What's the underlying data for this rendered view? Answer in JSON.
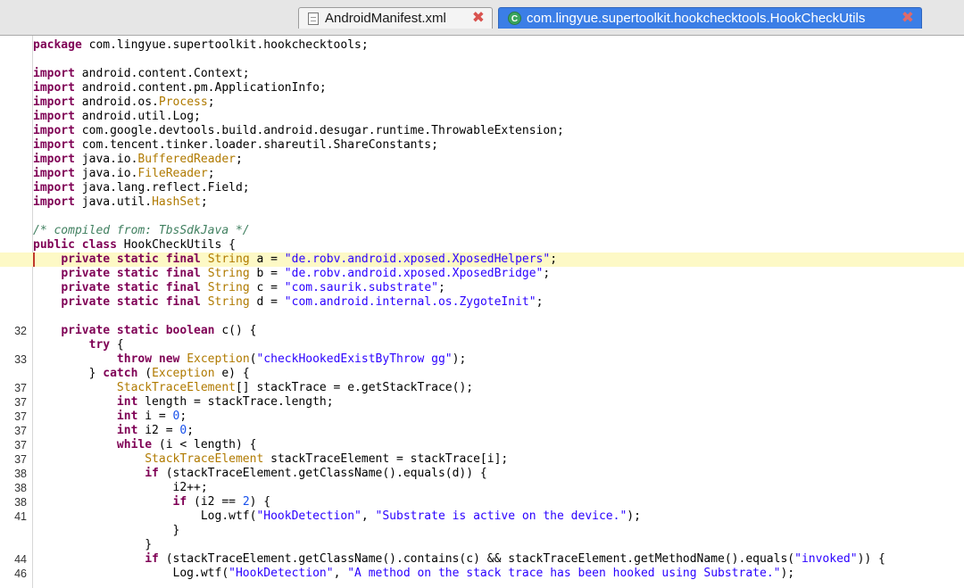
{
  "tabs": [
    {
      "label": "AndroidManifest.xml",
      "icon": "xml-file-icon",
      "active": false
    },
    {
      "label": "com.lingyue.supertoolkit.hookchecktools.HookCheckUtils",
      "icon": "class-c-icon",
      "active": true
    }
  ],
  "editor": {
    "highlighted_line_index": 15,
    "lines": [
      {
        "ln": "",
        "tokens": [
          [
            "k",
            "package"
          ],
          [
            "p",
            " com.lingyue.supertoolkit.hookchecktools;"
          ]
        ]
      },
      {
        "ln": "",
        "tokens": []
      },
      {
        "ln": "",
        "tokens": [
          [
            "k",
            "import"
          ],
          [
            "p",
            " android.content.Context;"
          ]
        ]
      },
      {
        "ln": "",
        "tokens": [
          [
            "k",
            "import"
          ],
          [
            "p",
            " android.content.pm.ApplicationInfo;"
          ]
        ]
      },
      {
        "ln": "",
        "tokens": [
          [
            "k",
            "import"
          ],
          [
            "p",
            " android.os."
          ],
          [
            "t",
            "Process"
          ],
          [
            "p",
            ";"
          ]
        ]
      },
      {
        "ln": "",
        "tokens": [
          [
            "k",
            "import"
          ],
          [
            "p",
            " android.util.Log;"
          ]
        ]
      },
      {
        "ln": "",
        "tokens": [
          [
            "k",
            "import"
          ],
          [
            "p",
            " com.google.devtools.build.android.desugar.runtime.ThrowableExtension;"
          ]
        ]
      },
      {
        "ln": "",
        "tokens": [
          [
            "k",
            "import"
          ],
          [
            "p",
            " com.tencent.tinker.loader.shareutil.ShareConstants;"
          ]
        ]
      },
      {
        "ln": "",
        "tokens": [
          [
            "k",
            "import"
          ],
          [
            "p",
            " java.io."
          ],
          [
            "t",
            "BufferedReader"
          ],
          [
            "p",
            ";"
          ]
        ]
      },
      {
        "ln": "",
        "tokens": [
          [
            "k",
            "import"
          ],
          [
            "p",
            " java.io."
          ],
          [
            "t",
            "FileReader"
          ],
          [
            "p",
            ";"
          ]
        ]
      },
      {
        "ln": "",
        "tokens": [
          [
            "k",
            "import"
          ],
          [
            "p",
            " java.lang.reflect.Field;"
          ]
        ]
      },
      {
        "ln": "",
        "tokens": [
          [
            "k",
            "import"
          ],
          [
            "p",
            " java.util."
          ],
          [
            "t",
            "HashSet"
          ],
          [
            "p",
            ";"
          ]
        ]
      },
      {
        "ln": "",
        "tokens": []
      },
      {
        "ln": "",
        "tokens": [
          [
            "c",
            "/* compiled from: TbsSdkJava */"
          ]
        ]
      },
      {
        "ln": "",
        "tokens": [
          [
            "k",
            "public"
          ],
          [
            "p",
            " "
          ],
          [
            "k",
            "class"
          ],
          [
            "p",
            " HookCheckUtils {"
          ]
        ]
      },
      {
        "ln": "",
        "tokens": [
          [
            "p",
            "    "
          ],
          [
            "k",
            "private static final"
          ],
          [
            "p",
            " "
          ],
          [
            "t",
            "String"
          ],
          [
            "p",
            " a = "
          ],
          [
            "s",
            "\"de.robv.android.xposed.XposedHelpers\""
          ],
          [
            "p",
            ";"
          ]
        ]
      },
      {
        "ln": "",
        "tokens": [
          [
            "p",
            "    "
          ],
          [
            "k",
            "private static final"
          ],
          [
            "p",
            " "
          ],
          [
            "t",
            "String"
          ],
          [
            "p",
            " b = "
          ],
          [
            "s",
            "\"de.robv.android.xposed.XposedBridge\""
          ],
          [
            "p",
            ";"
          ]
        ]
      },
      {
        "ln": "",
        "tokens": [
          [
            "p",
            "    "
          ],
          [
            "k",
            "private static final"
          ],
          [
            "p",
            " "
          ],
          [
            "t",
            "String"
          ],
          [
            "p",
            " c = "
          ],
          [
            "s",
            "\"com.saurik.substrate\""
          ],
          [
            "p",
            ";"
          ]
        ]
      },
      {
        "ln": "",
        "tokens": [
          [
            "p",
            "    "
          ],
          [
            "k",
            "private static final"
          ],
          [
            "p",
            " "
          ],
          [
            "t",
            "String"
          ],
          [
            "p",
            " d = "
          ],
          [
            "s",
            "\"com.android.internal.os.ZygoteInit\""
          ],
          [
            "p",
            ";"
          ]
        ]
      },
      {
        "ln": "",
        "tokens": []
      },
      {
        "ln": "32",
        "tokens": [
          [
            "p",
            "    "
          ],
          [
            "k",
            "private static boolean"
          ],
          [
            "p",
            " c() {"
          ]
        ]
      },
      {
        "ln": "",
        "tokens": [
          [
            "p",
            "        "
          ],
          [
            "k",
            "try"
          ],
          [
            "p",
            " {"
          ]
        ]
      },
      {
        "ln": "33",
        "tokens": [
          [
            "p",
            "            "
          ],
          [
            "k",
            "throw new"
          ],
          [
            "p",
            " "
          ],
          [
            "t",
            "Exception"
          ],
          [
            "p",
            "("
          ],
          [
            "s",
            "\"checkHookedExistByThrow gg\""
          ],
          [
            "p",
            ");"
          ]
        ]
      },
      {
        "ln": "",
        "tokens": [
          [
            "p",
            "        } "
          ],
          [
            "k",
            "catch"
          ],
          [
            "p",
            " ("
          ],
          [
            "t",
            "Exception"
          ],
          [
            "p",
            " e) {"
          ]
        ]
      },
      {
        "ln": "37",
        "tokens": [
          [
            "p",
            "            "
          ],
          [
            "t",
            "StackTraceElement"
          ],
          [
            "p",
            "[] stackTrace = e.getStackTrace();"
          ]
        ]
      },
      {
        "ln": "37",
        "tokens": [
          [
            "p",
            "            "
          ],
          [
            "k",
            "int"
          ],
          [
            "p",
            " length = stackTrace.length;"
          ]
        ]
      },
      {
        "ln": "37",
        "tokens": [
          [
            "p",
            "            "
          ],
          [
            "k",
            "int"
          ],
          [
            "p",
            " i = "
          ],
          [
            "n",
            "0"
          ],
          [
            "p",
            ";"
          ]
        ]
      },
      {
        "ln": "37",
        "tokens": [
          [
            "p",
            "            "
          ],
          [
            "k",
            "int"
          ],
          [
            "p",
            " i2 = "
          ],
          [
            "n",
            "0"
          ],
          [
            "p",
            ";"
          ]
        ]
      },
      {
        "ln": "37",
        "tokens": [
          [
            "p",
            "            "
          ],
          [
            "k",
            "while"
          ],
          [
            "p",
            " (i < length) {"
          ]
        ]
      },
      {
        "ln": "37",
        "tokens": [
          [
            "p",
            "                "
          ],
          [
            "t",
            "StackTraceElement"
          ],
          [
            "p",
            " stackTraceElement = stackTrace[i];"
          ]
        ]
      },
      {
        "ln": "38",
        "tokens": [
          [
            "p",
            "                "
          ],
          [
            "k",
            "if"
          ],
          [
            "p",
            " (stackTraceElement.getClassName().equals(d)) {"
          ]
        ]
      },
      {
        "ln": "38",
        "tokens": [
          [
            "p",
            "                    i2++;"
          ]
        ]
      },
      {
        "ln": "38",
        "tokens": [
          [
            "p",
            "                    "
          ],
          [
            "k",
            "if"
          ],
          [
            "p",
            " (i2 == "
          ],
          [
            "n",
            "2"
          ],
          [
            "p",
            ") {"
          ]
        ]
      },
      {
        "ln": "41",
        "tokens": [
          [
            "p",
            "                        Log.wtf("
          ],
          [
            "s",
            "\"HookDetection\""
          ],
          [
            "p",
            ", "
          ],
          [
            "s",
            "\"Substrate is active on the device.\""
          ],
          [
            "p",
            ");"
          ]
        ]
      },
      {
        "ln": "",
        "tokens": [
          [
            "p",
            "                    }"
          ]
        ]
      },
      {
        "ln": "",
        "tokens": [
          [
            "p",
            "                }"
          ]
        ]
      },
      {
        "ln": "44",
        "tokens": [
          [
            "p",
            "                "
          ],
          [
            "k",
            "if"
          ],
          [
            "p",
            " (stackTraceElement.getClassName().contains(c) && stackTraceElement.getMethodName().equals("
          ],
          [
            "s",
            "\"invoked\""
          ],
          [
            "p",
            ")) {"
          ]
        ]
      },
      {
        "ln": "46",
        "tokens": [
          [
            "p",
            "                    Log.wtf("
          ],
          [
            "s",
            "\"HookDetection\""
          ],
          [
            "p",
            ", "
          ],
          [
            "s",
            "\"A method on the stack trace has been hooked using Substrate.\""
          ],
          [
            "p",
            ");"
          ]
        ]
      }
    ]
  }
}
